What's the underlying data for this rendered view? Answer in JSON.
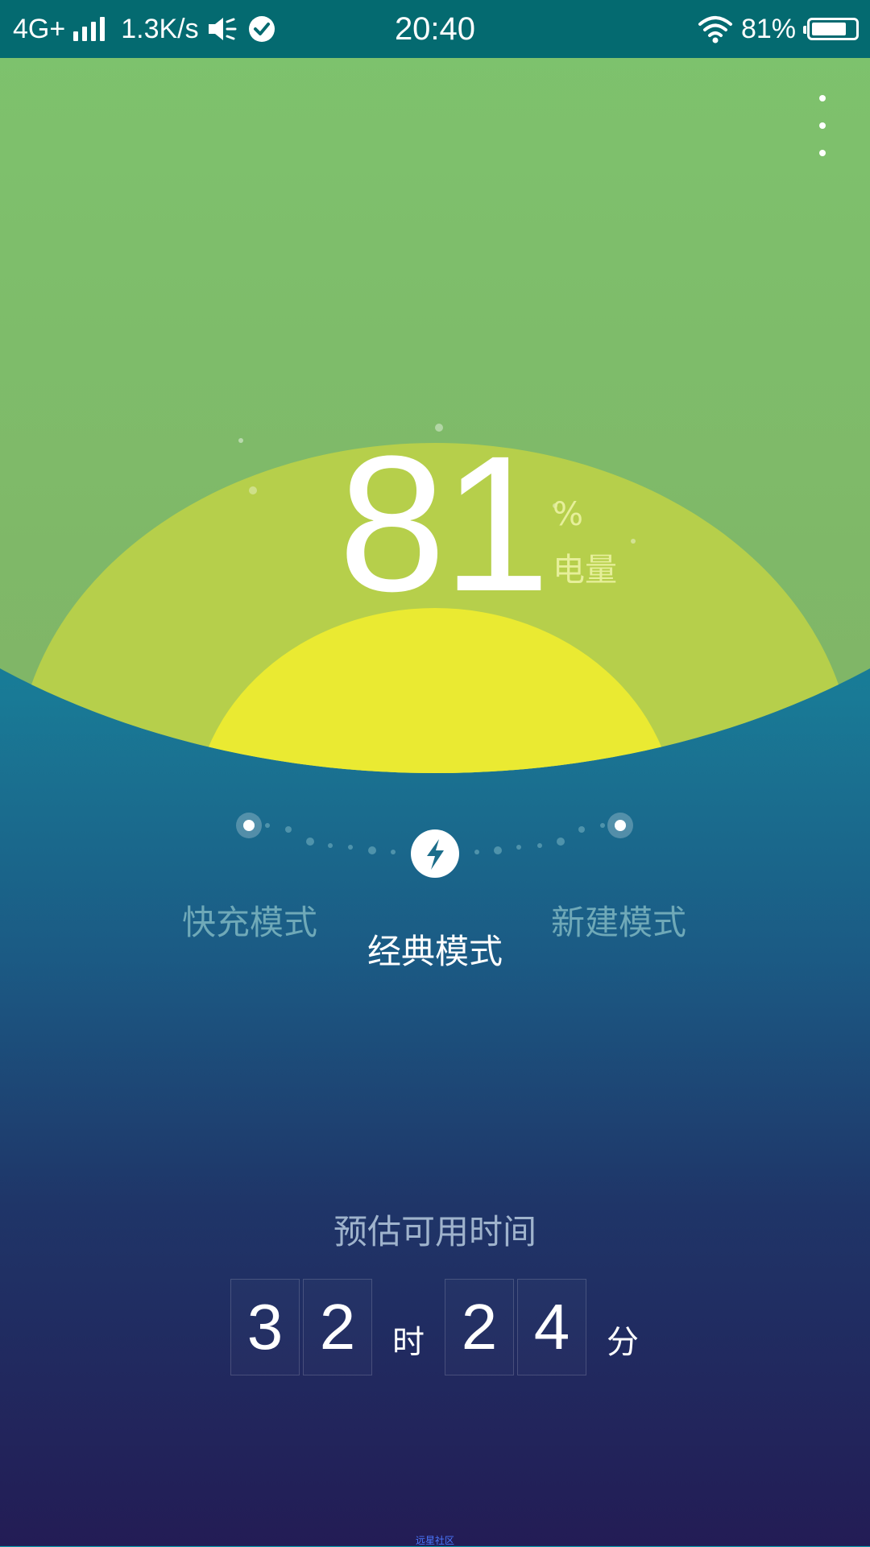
{
  "status_bar": {
    "network": "4G+",
    "speed": "1.3K/s",
    "time": "20:40",
    "battery_text": "81%",
    "battery_level": 0.81
  },
  "battery": {
    "value": "81",
    "percent_symbol": "%",
    "label": "电量"
  },
  "modes": [
    {
      "label": "快充模式",
      "active": false
    },
    {
      "label": "经典模式",
      "active": true
    },
    {
      "label": "新建模式",
      "active": false
    }
  ],
  "estimate": {
    "title": "预估可用时间",
    "hours_digits": [
      "3",
      "2"
    ],
    "hours_unit": "时",
    "minutes_digits": [
      "2",
      "4"
    ],
    "minutes_unit": "分"
  },
  "watermark": "远星社区",
  "colors": {
    "outer_arc": "#7cc56c",
    "middle_arc": "#b7cf4b",
    "inner_arc": "#eaea32",
    "status_bar": "#046a70"
  },
  "icons": [
    "signal-icon",
    "volume-icon",
    "check-circle-icon",
    "wifi-icon",
    "battery-icon",
    "more-vertical-icon",
    "lightning-icon"
  ]
}
